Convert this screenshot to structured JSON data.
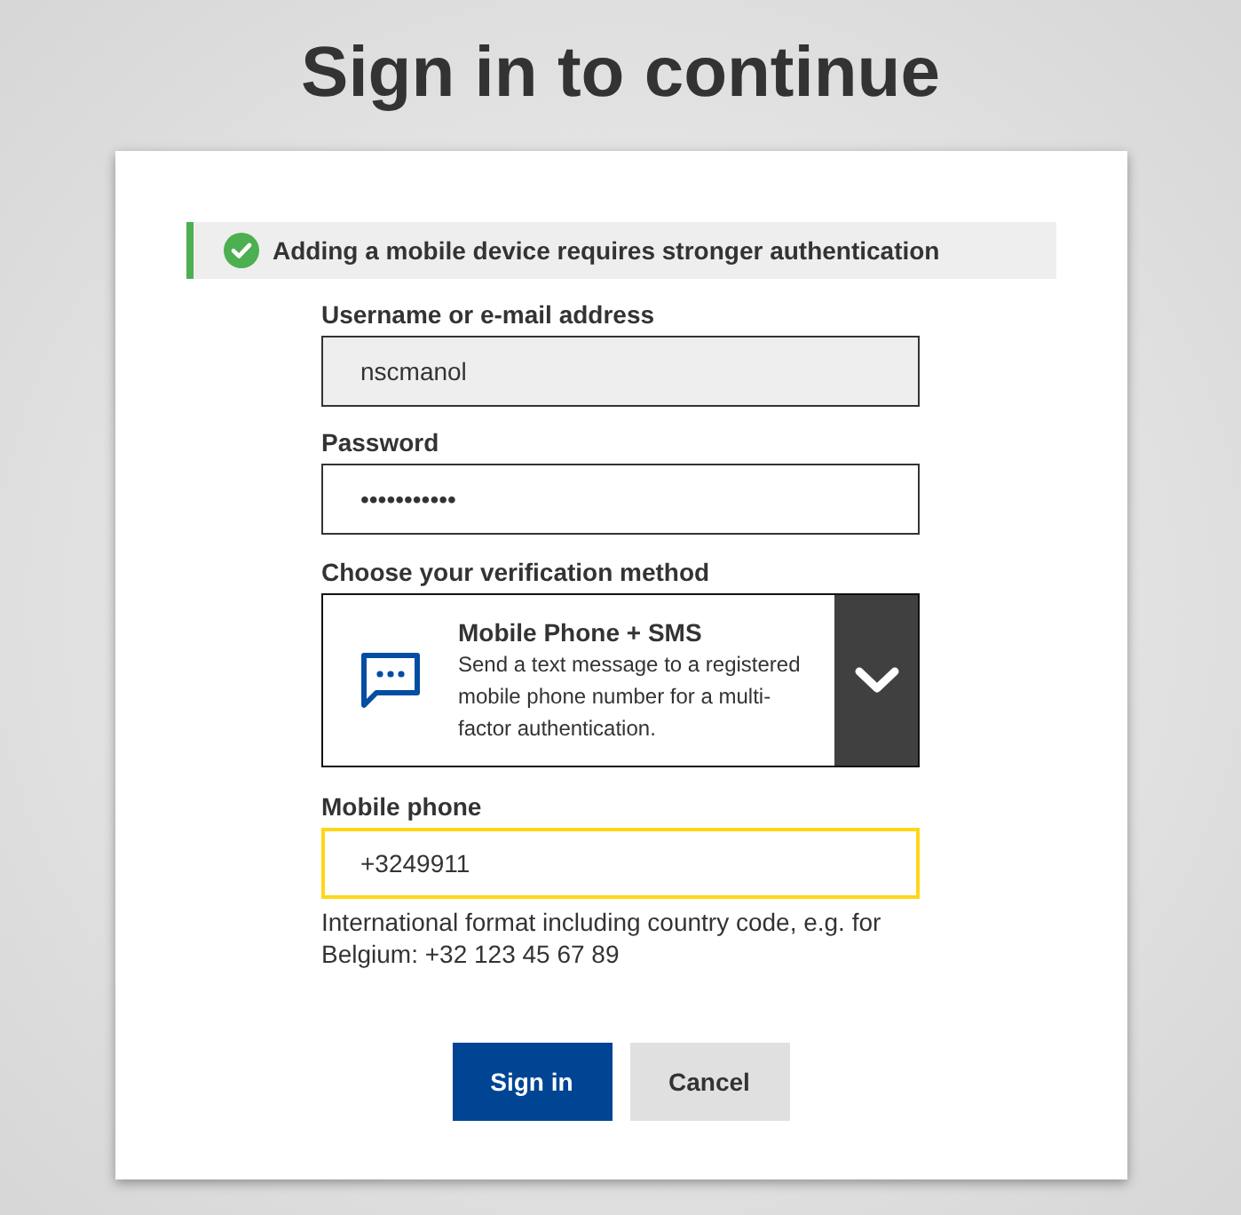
{
  "title": "Sign in to continue",
  "notice": {
    "kind": "success",
    "text": "Adding a mobile device requires stronger authentication"
  },
  "fields": [
    {
      "label": "Username or e-mail address",
      "value": "nscmanol",
      "disabled": true,
      "focused": false
    },
    {
      "label": "Password",
      "value": "•••••••••••",
      "disabled": false,
      "focused": false
    }
  ],
  "verification": {
    "label": "Choose your verification method",
    "method": "Mobile Phone + SMS",
    "description": "Send a text message to a registered mobile phone number for a multi-factor authentication."
  },
  "mobile_phone": {
    "label": "Mobile phone",
    "value": "+3249911",
    "disabled": false,
    "focused": true,
    "hint": "International format including country code, e.g. for Belgium: +32 123 45 67 89"
  },
  "buttons": [
    {
      "label": "Sign in",
      "kind": "primary"
    },
    {
      "label": "Cancel",
      "kind": "secondary"
    }
  ]
}
